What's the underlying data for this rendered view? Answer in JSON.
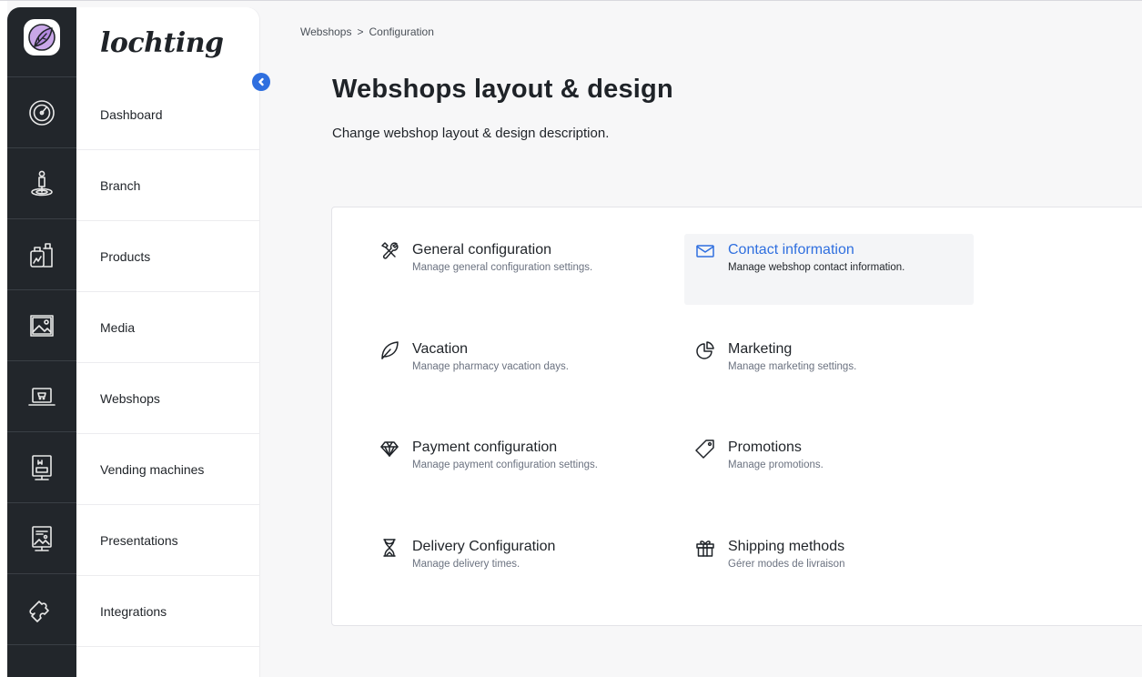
{
  "brand": "lochting",
  "sidebar": {
    "items": [
      {
        "label": "Dashboard"
      },
      {
        "label": "Branch"
      },
      {
        "label": "Products"
      },
      {
        "label": "Media"
      },
      {
        "label": "Webshops"
      },
      {
        "label": "Vending machines"
      },
      {
        "label": "Presentations"
      },
      {
        "label": "Integrations"
      }
    ]
  },
  "breadcrumb": {
    "parent": "Webshops",
    "separator": ">",
    "current": "Configuration"
  },
  "page": {
    "title": "Webshops layout & design",
    "description": "Change webshop layout & design description."
  },
  "config": {
    "items": [
      {
        "icon": "tools-icon",
        "title": "General configuration",
        "desc": "Manage general configuration settings."
      },
      {
        "icon": "envelope-icon",
        "title": "Contact information",
        "desc": "Manage webshop contact information.",
        "active": true
      },
      {
        "icon": "leaf-icon",
        "title": "Vacation",
        "desc": "Manage pharmacy vacation days."
      },
      {
        "icon": "pie-chart-icon",
        "title": "Marketing",
        "desc": "Manage marketing settings."
      },
      {
        "icon": "diamond-icon",
        "title": "Payment configuration",
        "desc": "Manage payment configuration settings."
      },
      {
        "icon": "tag-icon",
        "title": "Promotions",
        "desc": "Manage promotions."
      },
      {
        "icon": "hourglass-icon",
        "title": "Delivery Configuration",
        "desc": "Manage delivery times."
      },
      {
        "icon": "gift-icon",
        "title": "Shipping methods",
        "desc": "Gérer modes de livraison"
      }
    ]
  },
  "colors": {
    "accent": "#2f6fdf",
    "rail": "#22262b",
    "active_bg": "#f4f5f7"
  }
}
